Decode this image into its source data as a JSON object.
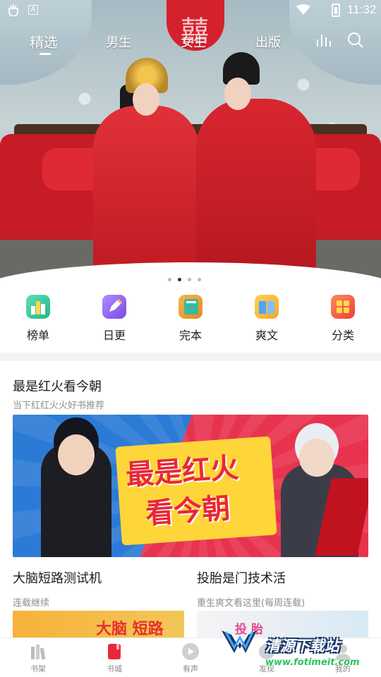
{
  "status_bar": {
    "time": "11:32",
    "notif_icon_a": "A"
  },
  "top_tabs": [
    {
      "label": "精选",
      "active": true
    },
    {
      "label": "男生",
      "active": false
    },
    {
      "label": "女生",
      "active": false
    },
    {
      "label": "出版",
      "active": false
    }
  ],
  "hero": {
    "slide_count": 4,
    "active_slide": 1
  },
  "quick_entries": [
    {
      "label": "榜单",
      "icon": "rank-chart-icon",
      "color": "#33c9a0"
    },
    {
      "label": "日更",
      "icon": "pencil-icon",
      "color": "#8a5cf0"
    },
    {
      "label": "完本",
      "icon": "book-icon",
      "color": "#2fb39a"
    },
    {
      "label": "爽文",
      "icon": "open-book-icon",
      "color": "#f5b726"
    },
    {
      "label": "分类",
      "icon": "grid-category-icon",
      "color": "#f0543a"
    }
  ],
  "section": {
    "title": "最是红火看今朝",
    "subtitle": "当下红红火火好书推荐",
    "banner_text_line1": "最是红火",
    "banner_text_line2": "看今朝"
  },
  "books": [
    {
      "title": "大脑短路测试机",
      "desc": "连载继续",
      "cover_text": "大脑 短路"
    },
    {
      "title": "投胎是门技术活",
      "desc": "重生爽文看这里(每周连载)",
      "cover_text": "投 胎"
    }
  ],
  "bottom_nav": [
    {
      "label": "书架",
      "icon": "bookshelf-icon",
      "active": false
    },
    {
      "label": "书城",
      "icon": "bookstore-icon",
      "active": true
    },
    {
      "label": "有声",
      "icon": "play-audio-icon",
      "active": false
    },
    {
      "label": "发现",
      "icon": "discover-icon",
      "active": false
    },
    {
      "label": "我的",
      "icon": "profile-icon",
      "active": false
    }
  ],
  "watermark": {
    "name": "清源下载站",
    "url": "www.fotimeit.com"
  },
  "colors": {
    "accent_red": "#e8283a",
    "text_primary": "#1d1d1d",
    "text_secondary": "#8e8e8e"
  }
}
